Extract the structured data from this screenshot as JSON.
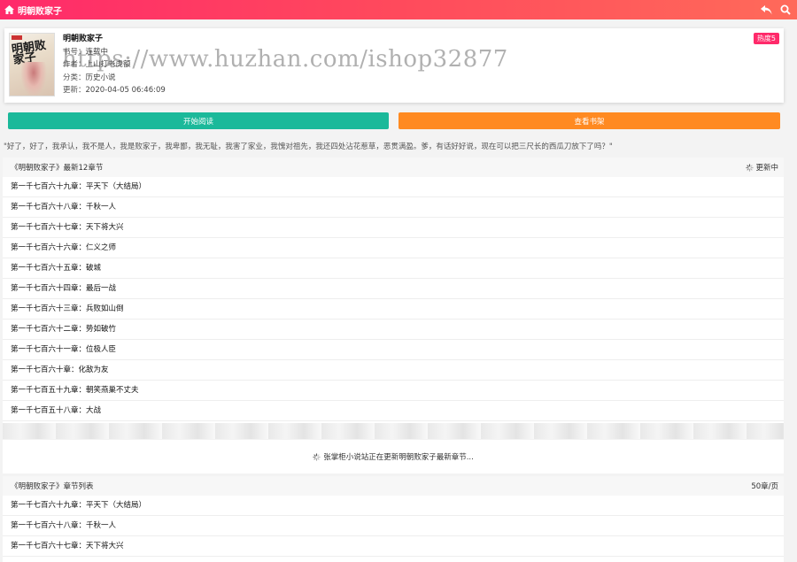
{
  "topbar": {
    "title": "明朝败家子",
    "home_icon": "home-icon",
    "back_icon": "back-icon",
    "search_icon": "search-icon"
  },
  "book": {
    "name": "明朝败家子",
    "book_no_label": "书号：",
    "book_no": "连载中",
    "author_label": "作者：",
    "author": "上山打老虎额",
    "category_label": "分类：",
    "category": "历史小说",
    "updated_label": "更新：",
    "updated": "2020-04-05 06:46:09",
    "hot_badge": "热度5",
    "cover_text": "明朝败家子",
    "watermark": "https://www.huzhan.com/ishop32877"
  },
  "buttons": {
    "start_reading": "开始阅读",
    "view_shelf": "查看书架"
  },
  "intro": "\"好了，好了，我承认，我不是人，我是败家子，我卑鄙，我无耻，我害了家业，我愧对祖先，我还四处沾花惹草，恶贯满盈。爹，有话好好说，现在可以把三尺长的西瓜刀放下了吗？\"",
  "latest": {
    "title": "《明朝败家子》最新12章节",
    "status": "更新中",
    "chapters": [
      "第一千七百六十九章：平天下（大结局）",
      "第一千七百六十八章：千秋一人",
      "第一千七百六十七章：天下将大兴",
      "第一千七百六十六章：仁义之师",
      "第一千七百六十五章：破城",
      "第一千七百六十四章：最后一战",
      "第一千七百六十三章：兵败如山倒",
      "第一千七百六十二章：势如破竹",
      "第一千七百六十一章：位极人臣",
      "第一千七百六十章：化敌为友",
      "第一千七百五十九章：朝笑燕巢不丈夫",
      "第一千七百五十八章：大战"
    ]
  },
  "updating_text": "张掌柜小说站正在更新明朝败家子最新章节...",
  "list": {
    "title": "《明朝败家子》章节列表",
    "per_page": "50章/页",
    "chapters": [
      "第一千七百六十九章：平天下（大结局）",
      "第一千七百六十八章：千秋一人",
      "第一千七百六十七章：天下将大兴"
    ]
  }
}
